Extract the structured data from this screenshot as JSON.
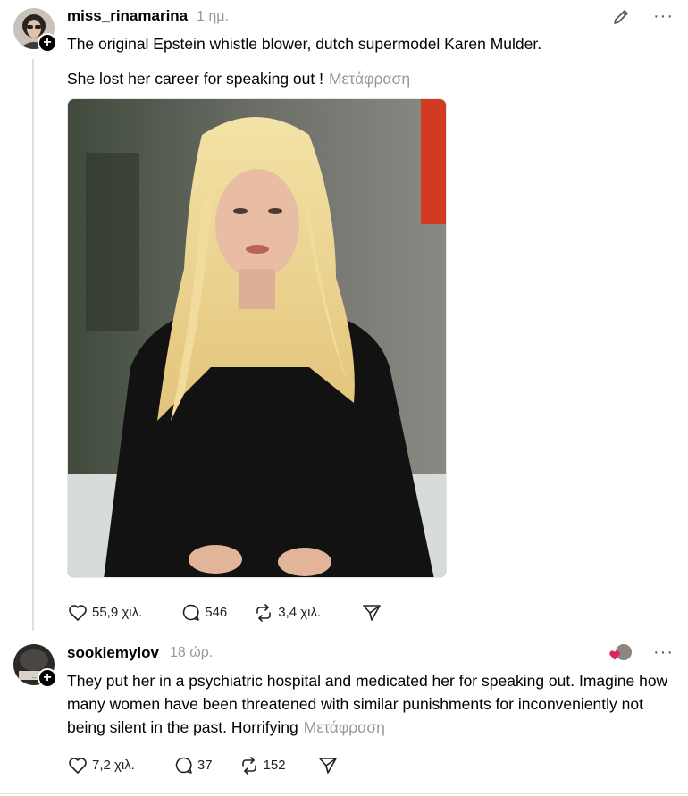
{
  "post1": {
    "username": "miss_rinamarina",
    "time": "1 ημ.",
    "line1": "The original Epstein whistle blower, dutch supermodel Karen Mulder.",
    "line2": "She lost her career for speaking out !",
    "translate": "Μετάφραση",
    "likes": "55,9 χιλ.",
    "comments": "546",
    "reposts": "3,4 χιλ.",
    "more": "···"
  },
  "post2": {
    "username": "sookiemylov",
    "time": "18 ώρ.",
    "text": "They put her in a psychiatric hospital and medicated her for speaking out. Imagine how many women have been threatened with similar punishments for inconveniently not being silent in the past. Horrifying",
    "translate": "Μετάφραση",
    "likes": "7,2 χιλ.",
    "comments": "37",
    "reposts": "152",
    "more": "···"
  },
  "colors": {
    "muted": "#999999",
    "heart": "#e0245e",
    "line": "#e0e0e0"
  },
  "icons": [
    "edit-pencil-icon",
    "more-icon",
    "heart-icon",
    "comment-icon",
    "repost-icon",
    "share-icon",
    "plus-icon"
  ]
}
